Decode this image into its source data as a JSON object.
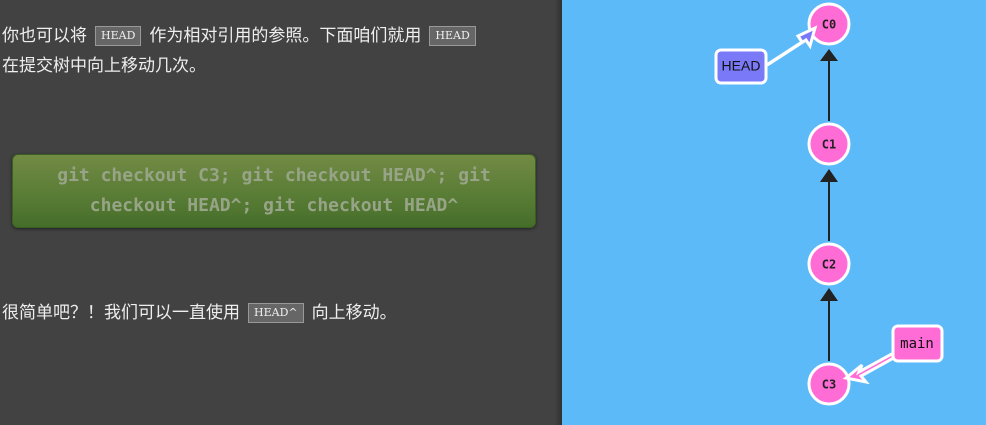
{
  "instructions": {
    "para1_a": "你也可以将",
    "para1_tag1": "HEAD",
    "para1_b": "作为相对引用的参照。下面咱们就用",
    "para1_tag2": "HEAD",
    "para1_c": "在提交树中向上移动几次。",
    "para2_a": "很简单吧？！我们可以一直使用",
    "para2_tag": "HEAD^",
    "para2_b": "向上移动。"
  },
  "command": {
    "text": "git checkout C3; git checkout HEAD^; git checkout HEAD^; git checkout HEAD^"
  },
  "tree": {
    "commits": [
      "C0",
      "C1",
      "C2",
      "C3"
    ],
    "refs": {
      "head": "HEAD",
      "main": "main"
    }
  },
  "colors": {
    "left_bg": "#424242",
    "right_bg": "#5cbaf8",
    "commit_fill": "#ff6cd5",
    "head_fill": "#7a7af8",
    "command_box": "#5a7d36"
  }
}
